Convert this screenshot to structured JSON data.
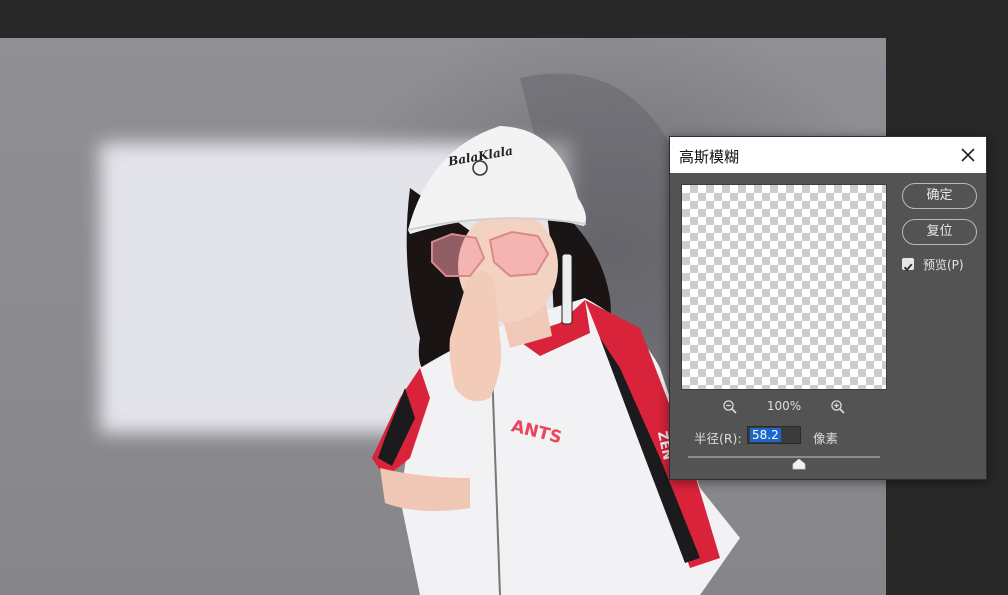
{
  "dialog": {
    "title": "高斯模糊",
    "ok_label": "确定",
    "reset_label": "复位",
    "preview_label": "预览(P)",
    "preview_checked": true,
    "zoom_level": "100%",
    "radius_label": "半径(R):",
    "radius_value": "58.2",
    "radius_unit": "像素",
    "slider_fraction": 0.58
  },
  "photo": {
    "cap_text": "BalaKlala",
    "jersey_text": "ANTS",
    "sleeve_text": "ZEN"
  },
  "icons": {
    "close": "close-icon",
    "zoom_out": "zoom-out-icon",
    "zoom_in": "zoom-in-icon",
    "check": "checkmark-icon",
    "thumb": "slider-thumb-icon"
  },
  "colors": {
    "app_bg": "#282828",
    "dialog_bg": "#535353",
    "selection": "#1c67c9",
    "jersey_red": "#d8233a"
  }
}
